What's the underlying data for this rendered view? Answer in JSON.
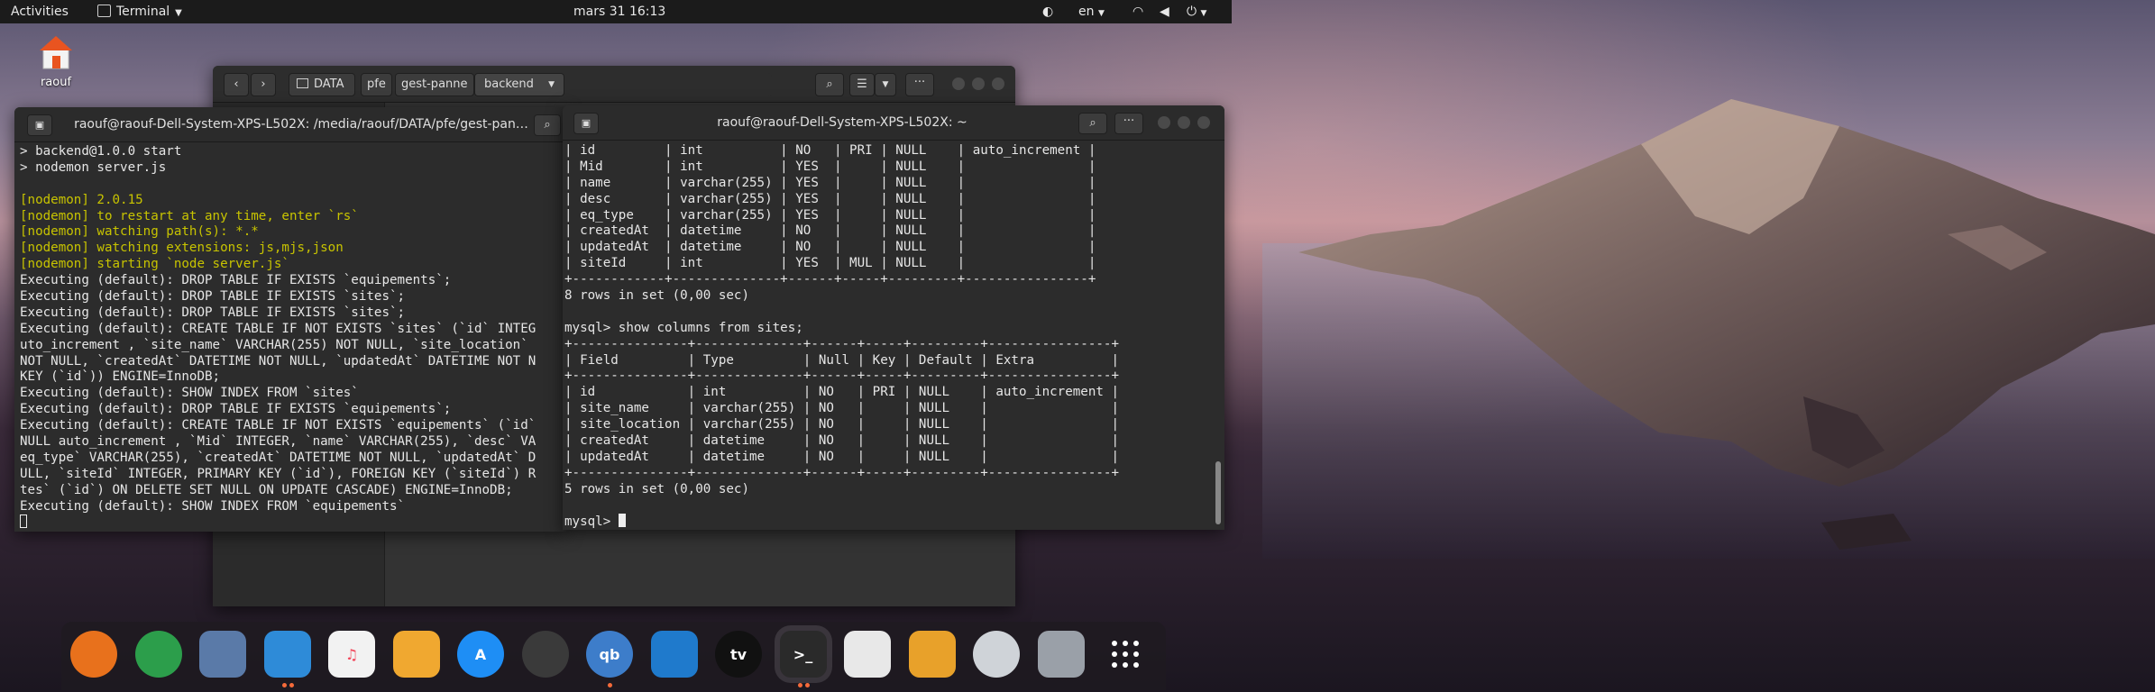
{
  "topbar": {
    "activities": "Activities",
    "app_menu": "Terminal",
    "clock": "mars 31  16:13",
    "lang": "en"
  },
  "desktop": {
    "home_label": "raouf"
  },
  "files_window": {
    "path": [
      "DATA",
      "pfe",
      "gest-panne",
      "backend"
    ]
  },
  "terminal_left": {
    "title": "raouf@raouf-Dell-System-XPS-L502X: /media/raouf/DATA/pfe/gest-pan…",
    "lines": [
      {
        "t": "> backend@1.0.0 start",
        "c": ""
      },
      {
        "t": "> nodemon server.js",
        "c": ""
      },
      {
        "t": "",
        "c": ""
      },
      {
        "t": "[nodemon] 2.0.15",
        "c": "yel"
      },
      {
        "t": "[nodemon] to restart at any time, enter `rs`",
        "c": "yel"
      },
      {
        "t": "[nodemon] watching path(s): *.*",
        "c": "yel"
      },
      {
        "t": "[nodemon] watching extensions: js,mjs,json",
        "c": "yel"
      },
      {
        "t": "[nodemon] starting `node server.js`",
        "c": "yel"
      },
      {
        "t": "Executing (default): DROP TABLE IF EXISTS `equipements`;",
        "c": ""
      },
      {
        "t": "Executing (default): DROP TABLE IF EXISTS `sites`;",
        "c": ""
      },
      {
        "t": "Executing (default): DROP TABLE IF EXISTS `sites`;",
        "c": ""
      },
      {
        "t": "Executing (default): CREATE TABLE IF NOT EXISTS `sites` (`id` INTEG",
        "c": ""
      },
      {
        "t": "uto_increment , `site_name` VARCHAR(255) NOT NULL, `site_location`",
        "c": ""
      },
      {
        "t": "NOT NULL, `createdAt` DATETIME NOT NULL, `updatedAt` DATETIME NOT N",
        "c": ""
      },
      {
        "t": "KEY (`id`)) ENGINE=InnoDB;",
        "c": ""
      },
      {
        "t": "Executing (default): SHOW INDEX FROM `sites`",
        "c": ""
      },
      {
        "t": "Executing (default): DROP TABLE IF EXISTS `equipements`;",
        "c": ""
      },
      {
        "t": "Executing (default): CREATE TABLE IF NOT EXISTS `equipements` (`id`",
        "c": ""
      },
      {
        "t": "NULL auto_increment , `Mid` INTEGER, `name` VARCHAR(255), `desc` VA",
        "c": ""
      },
      {
        "t": "eq_type` VARCHAR(255), `createdAt` DATETIME NOT NULL, `updatedAt` D",
        "c": ""
      },
      {
        "t": "ULL, `siteId` INTEGER, PRIMARY KEY (`id`), FOREIGN KEY (`siteId`) R",
        "c": ""
      },
      {
        "t": "tes` (`id`) ON DELETE SET NULL ON UPDATE CASCADE) ENGINE=InnoDB;",
        "c": ""
      },
      {
        "t": "Executing (default): SHOW INDEX FROM `equipements`",
        "c": ""
      }
    ]
  },
  "terminal_right": {
    "title": "raouf@raouf-Dell-System-XPS-L502X: ~",
    "lines": [
      "| id         | int          | NO   | PRI | NULL    | auto_increment |",
      "| Mid        | int          | YES  |     | NULL    |                |",
      "| name       | varchar(255) | YES  |     | NULL    |                |",
      "| desc       | varchar(255) | YES  |     | NULL    |                |",
      "| eq_type    | varchar(255) | YES  |     | NULL    |                |",
      "| createdAt  | datetime     | NO   |     | NULL    |                |",
      "| updatedAt  | datetime     | NO   |     | NULL    |                |",
      "| siteId     | int          | YES  | MUL | NULL    |                |",
      "+------------+--------------+------+-----+---------+----------------+",
      "8 rows in set (0,00 sec)",
      "",
      "mysql> show columns from sites;",
      "+---------------+--------------+------+-----+---------+----------------+",
      "| Field         | Type         | Null | Key | Default | Extra          |",
      "+---------------+--------------+------+-----+---------+----------------+",
      "| id            | int          | NO   | PRI | NULL    | auto_increment |",
      "| site_name     | varchar(255) | NO   |     | NULL    |                |",
      "| site_location | varchar(255) | NO   |     | NULL    |                |",
      "| createdAt     | datetime     | NO   |     | NULL    |                |",
      "| updatedAt     | datetime     | NO   |     | NULL    |                |",
      "+---------------+--------------+------+-----+---------+----------------+",
      "5 rows in set (0,00 sec)",
      ""
    ],
    "prompt": "mysql> "
  },
  "dock": {
    "items": [
      {
        "name": "firefox-icon",
        "label": "",
        "color": "#e8711c"
      },
      {
        "name": "chrome-icon",
        "label": "",
        "color": "#2c9e4b"
      },
      {
        "name": "mail-icon",
        "label": "",
        "color": "#5a7aa8"
      },
      {
        "name": "finder-icon",
        "label": "",
        "color": "#2e8bd8"
      },
      {
        "name": "music-icon",
        "label": "♫",
        "color": "#f2f2f2"
      },
      {
        "name": "pages-icon",
        "label": "",
        "color": "#f0a830"
      },
      {
        "name": "appstore-icon",
        "label": "A",
        "color": "#1e8ef5"
      },
      {
        "name": "settings-icon",
        "label": "",
        "color": "#3a3a3a"
      },
      {
        "name": "qbittorrent-icon",
        "label": "qb",
        "color": "#3d7dca"
      },
      {
        "name": "vscode-icon",
        "label": "",
        "color": "#1f7acc"
      },
      {
        "name": "appletv-icon",
        "label": "tv",
        "color": "#111111"
      },
      {
        "name": "terminal-icon",
        "label": ">_",
        "color": "#2a2a2a"
      },
      {
        "name": "screenshot-icon",
        "label": "",
        "color": "#e8e8e8"
      },
      {
        "name": "drive-icon",
        "label": "",
        "color": "#e8a12a"
      },
      {
        "name": "dvd-icon",
        "label": "",
        "color": "#cfd3d8"
      },
      {
        "name": "printer-icon",
        "label": "",
        "color": "#9aa0a8"
      },
      {
        "name": "app-grid-icon",
        "label": "",
        "color": "transparent"
      }
    ]
  }
}
